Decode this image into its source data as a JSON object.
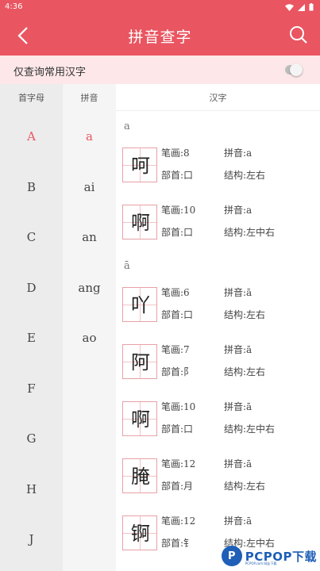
{
  "status_bar": {
    "time": "4:36"
  },
  "header": {
    "title": "拼音查字"
  },
  "filter": {
    "label": "仅查询常用汉字",
    "enabled": false
  },
  "columns": {
    "initial": "首字母",
    "pinyin": "拼音",
    "hanzi": "汉字"
  },
  "initials": [
    {
      "label": "A",
      "active": true
    },
    {
      "label": "B",
      "active": false
    },
    {
      "label": "C",
      "active": false
    },
    {
      "label": "D",
      "active": false
    },
    {
      "label": "E",
      "active": false
    },
    {
      "label": "F",
      "active": false
    },
    {
      "label": "G",
      "active": false
    },
    {
      "label": "H",
      "active": false
    },
    {
      "label": "J",
      "active": false
    }
  ],
  "pinyins": [
    {
      "label": "a",
      "active": true
    },
    {
      "label": "ai",
      "active": false
    },
    {
      "label": "an",
      "active": false
    },
    {
      "label": "ang",
      "active": false
    },
    {
      "label": "ao",
      "active": false
    }
  ],
  "groups": [
    {
      "label": "a",
      "chars": [
        {
          "char": "呵",
          "strokes": "笔画:8",
          "pinyin": "拼音:a",
          "radical": "部首:口",
          "structure": "结构:左右"
        },
        {
          "char": "啊",
          "strokes": "笔画:10",
          "pinyin": "拼音:a",
          "radical": "部首:口",
          "structure": "结构:左中右"
        }
      ]
    },
    {
      "label": "ā",
      "chars": [
        {
          "char": "吖",
          "strokes": "笔画:6",
          "pinyin": "拼音:ā",
          "radical": "部首:口",
          "structure": "结构:左右"
        },
        {
          "char": "阿",
          "strokes": "笔画:7",
          "pinyin": "拼音:ā",
          "radical": "部首:阝",
          "structure": "结构:左右"
        },
        {
          "char": "啊",
          "strokes": "笔画:10",
          "pinyin": "拼音:ā",
          "radical": "部首:口",
          "structure": "结构:左中右"
        },
        {
          "char": "腌",
          "strokes": "笔画:12",
          "pinyin": "拼音:ā",
          "radical": "部首:月",
          "structure": "结构:左右"
        },
        {
          "char": "锕",
          "strokes": "笔画:12",
          "pinyin": "拼音:ā",
          "radical": "部首:钅",
          "structure": "结构:左中右"
        }
      ]
    }
  ],
  "watermark": {
    "logo": "P",
    "text": "PCPOP下载",
    "sub": "PCPOP.com 网友下载"
  },
  "colors": {
    "accent": "#e95561",
    "filter_bg": "#fde7e9"
  }
}
